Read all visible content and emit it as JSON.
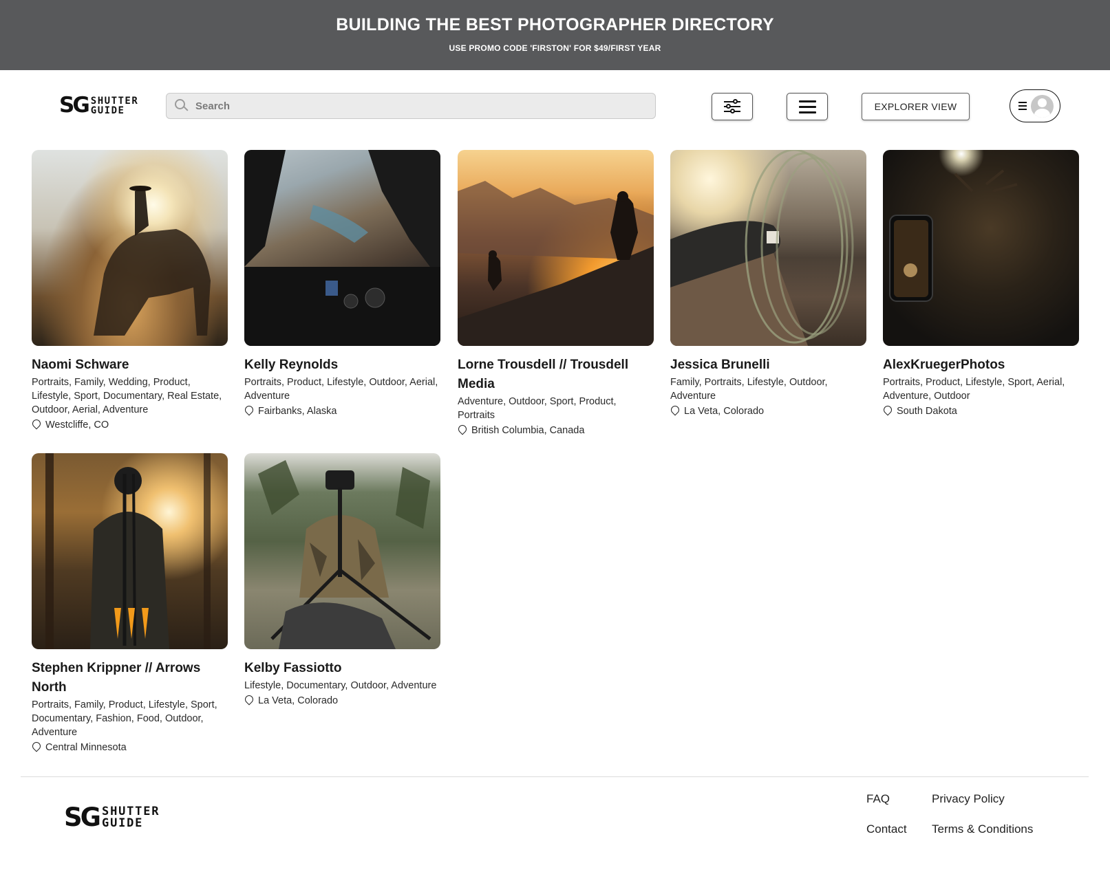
{
  "promo": {
    "title": "BUILDING THE BEST PHOTOGRAPHER DIRECTORY",
    "subtitle": "USE PROMO CODE 'FIRSTON' FOR $49/FIRST YEAR"
  },
  "brand": {
    "mark": "SG",
    "word1": "SHUTTER",
    "word2": "GUIDE"
  },
  "search": {
    "placeholder": "Search",
    "value": ""
  },
  "header": {
    "filter_icon": "sliders-icon",
    "menu_icon": "hamburger-icon",
    "explorer_label": "EXPLORER VIEW",
    "account_icon": "user-avatar-icon"
  },
  "photographers": [
    {
      "name": "Naomi Schware",
      "tags": "Portraits, Family, Wedding, Product, Lifestyle, Sport, Documentary, Real Estate, Outdoor, Aerial, Adventure",
      "location": "Westcliffe, CO"
    },
    {
      "name": "Kelly Reynolds",
      "tags": "Portraits, Product, Lifestyle, Outdoor, Aerial, Adventure",
      "location": "Fairbanks, Alaska"
    },
    {
      "name": "Lorne Trousdell // Trousdell Media",
      "tags": "Adventure, Outdoor, Sport, Product, Portraits",
      "location": "British Columbia, Canada"
    },
    {
      "name": "Jessica Brunelli",
      "tags": "Family, Portraits, Lifestyle, Outdoor, Adventure",
      "location": "La Veta, Colorado"
    },
    {
      "name": "AlexKruegerPhotos",
      "tags": "Portraits, Product, Lifestyle, Sport, Aerial, Adventure, Outdoor",
      "location": "South Dakota"
    },
    {
      "name": "Stephen Krippner // Arrows North",
      "tags": "Portraits, Family, Product, Lifestyle, Sport, Documentary, Fashion, Food, Outdoor, Adventure",
      "location": "Central Minnesota"
    },
    {
      "name": "Kelby Fassiotto",
      "tags": "Lifestyle, Documentary, Outdoor, Adventure",
      "location": "La Veta, Colorado"
    }
  ],
  "footer": {
    "faq": "FAQ",
    "privacy": "Privacy Policy",
    "contact": "Contact",
    "terms": "Terms & Conditions"
  }
}
